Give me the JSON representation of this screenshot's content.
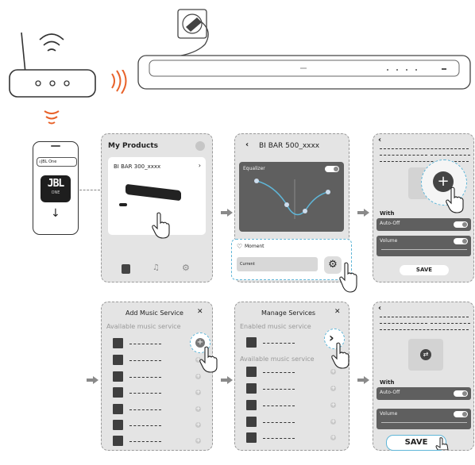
{
  "phone": {
    "search_text": "JBL One",
    "app_tile_text": "JBL"
  },
  "my_products": {
    "title": "My Products",
    "device_name": "BI BAR 300_xxxx"
  },
  "eq_screen": {
    "title": "BI BAR 500_xxxx",
    "equalizer_label": "Equalizer",
    "moment_label": "Moment",
    "current_label": "Current"
  },
  "moment_screen": {
    "with_label": "With",
    "auto_off_label": "Auto-Off",
    "volume_label": "Volume",
    "save_label": "SAVE"
  },
  "add_service": {
    "title": "Add Music Service",
    "subtitle": "Available music service"
  },
  "manage_services": {
    "title": "Manage Services",
    "enabled_label": "Enabled music service",
    "available_label": "Available music service"
  },
  "final_screen": {
    "with_label": "With",
    "auto_off_label": "Auto-Off",
    "volume_label": "Volume",
    "save_label": "SAVE"
  },
  "row_placeholder": "- - - - - -",
  "colors": {
    "wifi": "#e8622a",
    "screen_bg": "#e4e4e4",
    "panel_dark": "#5a5a5a",
    "highlight": "#5fb6d8"
  }
}
